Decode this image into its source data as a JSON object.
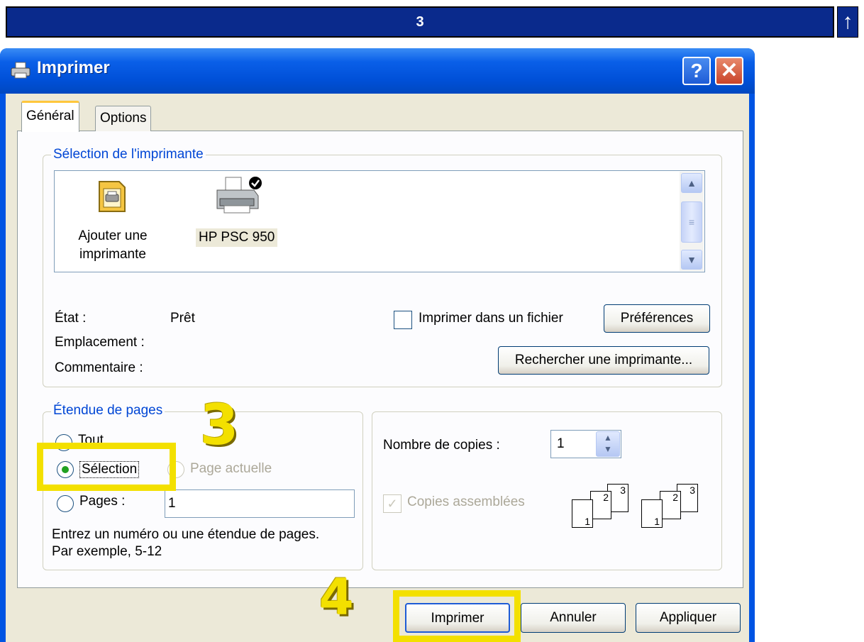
{
  "banner": {
    "step_number": "3",
    "up_arrow": "↑"
  },
  "window": {
    "title": "Imprimer",
    "help": "?",
    "close": "✕"
  },
  "tabs": [
    {
      "label": "Général"
    },
    {
      "label": "Options"
    }
  ],
  "printer_selection": {
    "legend": "Sélection de l'imprimante",
    "items": [
      {
        "label_line1": "Ajouter une",
        "label_line2": "imprimante",
        "icon": "add-printer-icon"
      },
      {
        "label": "HP PSC 950",
        "icon": "printer-default-icon",
        "selected": true
      }
    ],
    "status_label": "État :",
    "status_value": "Prêt",
    "location_label": "Emplacement :",
    "comment_label": "Commentaire :",
    "print_to_file_label": "Imprimer dans un fichier",
    "print_to_file_checked": false,
    "preferences_button": "Préférences",
    "find_printer_button": "Rechercher une imprimante..."
  },
  "page_range": {
    "legend": "Étendue de pages",
    "all_label": "Tout",
    "selection_label": "Sélection",
    "current_page_label": "Page actuelle",
    "pages_label": "Pages :",
    "pages_value": "1",
    "selected_option": "Sélection",
    "help_line1": "Entrez un numéro ou une étendue de pages.",
    "help_line2": "Par exemple, 5-12"
  },
  "copies": {
    "count_label": "Nombre de copies :",
    "count_value": "1",
    "collate_label": "Copies assemblées",
    "collate_checked": true,
    "collate_disabled": true,
    "page_numbers": [
      "1",
      "2",
      "3"
    ]
  },
  "buttons": {
    "print": "Imprimer",
    "cancel": "Annuler",
    "apply": "Appliquer"
  },
  "annotations": {
    "step3": "3",
    "step4": "4",
    "highlight_color": "#f3e000"
  },
  "colors": {
    "titlebar": "#0054e3",
    "dialog_bg": "#ece9d8",
    "legend_text": "#0046d5"
  }
}
